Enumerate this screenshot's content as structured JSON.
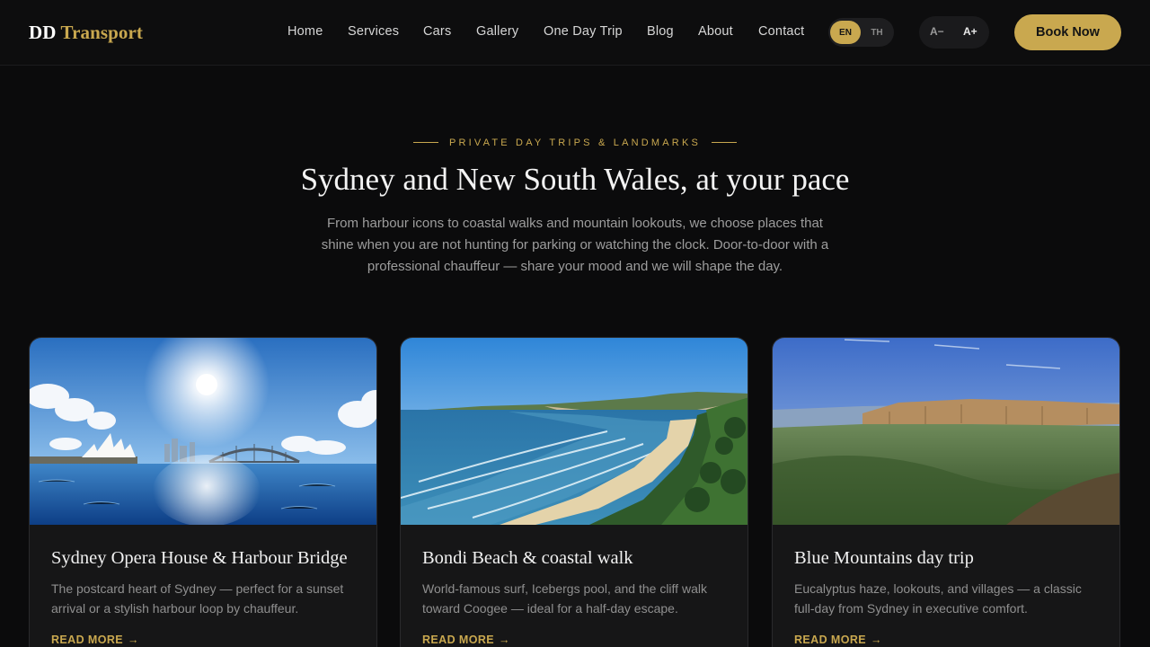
{
  "brand": {
    "name_part1": "DD",
    "name_part2": "Transport",
    "accent_color": "#c9a84f"
  },
  "nav": {
    "items": [
      {
        "label": "Home"
      },
      {
        "label": "Services"
      },
      {
        "label": "Cars"
      },
      {
        "label": "Gallery"
      },
      {
        "label": "One Day Trip"
      },
      {
        "label": "Blog"
      },
      {
        "label": "About"
      },
      {
        "label": "Contact"
      }
    ]
  },
  "language": {
    "active": "EN",
    "inactive": "TH"
  },
  "font_size": {
    "decrease": "A−",
    "increase": "A+"
  },
  "cta": {
    "book_now": "Book Now"
  },
  "hero": {
    "eyebrow": "PRIVATE DAY TRIPS & LANDMARKS",
    "title": "Sydney and New South Wales, at your pace",
    "subtitle": "From harbour icons to coastal walks and mountain lookouts, we choose places that shine when you are not hunting for parking or watching the clock. Door-to-door with a professional chauffeur — share your mood and we will shape the day."
  },
  "cards": [
    {
      "title": "Sydney Opera House & Harbour Bridge",
      "description": "The postcard heart of Sydney — perfect for a sunset arrival or a stylish harbour loop by chauffeur.",
      "link": "READ MORE",
      "image": "opera-house-harbour-photo"
    },
    {
      "title": "Bondi Beach & coastal walk",
      "description": "World-famous surf, Icebergs pool, and the cliff walk toward Coogee — ideal for a half-day escape.",
      "link": "READ MORE",
      "image": "coastal-beach-photo"
    },
    {
      "title": "Blue Mountains day trip",
      "description": "Eucalyptus haze, lookouts, and villages — a classic full-day from Sydney in executive comfort.",
      "link": "READ MORE",
      "image": "blue-mountains-photo"
    }
  ]
}
